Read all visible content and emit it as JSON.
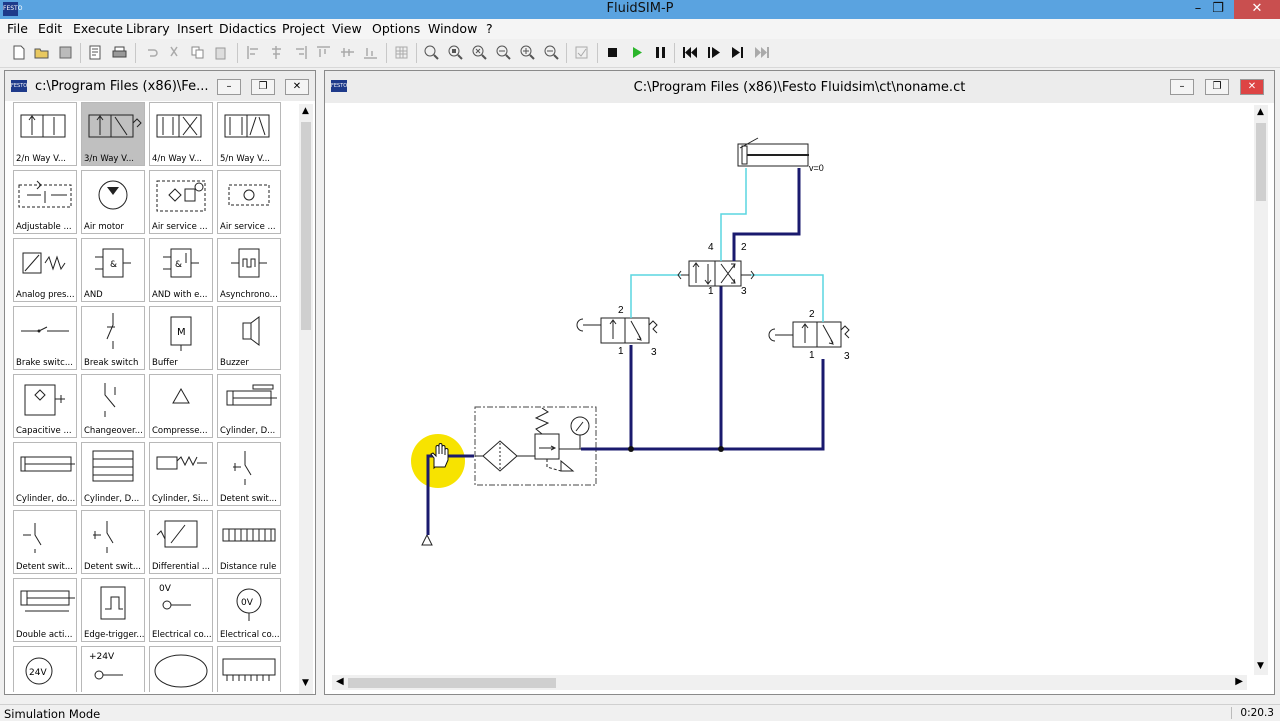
{
  "app": {
    "title": "FluidSIM-P",
    "logo_text": "FESTO"
  },
  "menu": [
    "File",
    "Edit",
    "Execute",
    "Library",
    "Insert",
    "Didactics",
    "Project",
    "View",
    "Options",
    "Window",
    "?"
  ],
  "library": {
    "title": "c:\\Program Files (x86)\\Fe...",
    "items": [
      {
        "label": "2/n Way V...",
        "icon": "valve-2n-icon"
      },
      {
        "label": "3/n Way V...",
        "icon": "valve-3n-icon"
      },
      {
        "label": "4/n Way V...",
        "icon": "valve-4n-icon"
      },
      {
        "label": "5/n Way V...",
        "icon": "valve-5n-icon"
      },
      {
        "label": "Adjustable ...",
        "icon": "adjustable-icon"
      },
      {
        "label": "Air motor",
        "icon": "air-motor-icon"
      },
      {
        "label": "Air service ...",
        "icon": "air-service-icon"
      },
      {
        "label": "Air service ...",
        "icon": "air-service-simple-icon"
      },
      {
        "label": "Analog pres...",
        "icon": "analog-pressure-icon"
      },
      {
        "label": "AND",
        "icon": "and-icon"
      },
      {
        "label": "AND with e...",
        "icon": "and-extended-icon"
      },
      {
        "label": "Asynchrono...",
        "icon": "asynchronous-icon"
      },
      {
        "label": "Brake switc...",
        "icon": "brake-switch-icon"
      },
      {
        "label": "Break switch",
        "icon": "break-switch-icon"
      },
      {
        "label": "Buffer",
        "icon": "buffer-icon"
      },
      {
        "label": "Buzzer",
        "icon": "buzzer-icon"
      },
      {
        "label": "Capacitive ...",
        "icon": "capacitive-icon"
      },
      {
        "label": "Changeover...",
        "icon": "changeover-icon"
      },
      {
        "label": "Compresse...",
        "icon": "compressed-air-icon"
      },
      {
        "label": "Cylinder, D...",
        "icon": "cylinder-d-icon"
      },
      {
        "label": "Cylinder, do...",
        "icon": "cylinder-do-icon"
      },
      {
        "label": "Cylinder, D...",
        "icon": "cylinder-d2-icon"
      },
      {
        "label": "Cylinder, Si...",
        "icon": "cylinder-si-icon"
      },
      {
        "label": "Detent swit...",
        "icon": "detent-switch-icon"
      },
      {
        "label": "Detent swit...",
        "icon": "detent-switch-2-icon"
      },
      {
        "label": "Detent swit...",
        "icon": "detent-switch-3-icon"
      },
      {
        "label": "Differential ...",
        "icon": "differential-icon"
      },
      {
        "label": "Distance rule",
        "icon": "distance-rule-icon"
      },
      {
        "label": "Double acti...",
        "icon": "double-acting-icon"
      },
      {
        "label": "Edge-trigger...",
        "icon": "edge-trigger-icon"
      },
      {
        "label": "Electrical co...",
        "icon": "electrical-connection-icon"
      },
      {
        "label": "Electrical co...",
        "icon": "electrical-ov-icon"
      },
      {
        "label": "",
        "icon": "voltage-24v-icon"
      },
      {
        "label": "",
        "icon": "voltage-24v-terminal-icon"
      },
      {
        "label": "",
        "icon": "ellipse-icon"
      },
      {
        "label": "",
        "icon": "terminal-strip-icon"
      }
    ]
  },
  "circuit": {
    "title": "C:\\Program Files (x86)\\Festo Fluidsim\\ct\\noname.ct",
    "cylinder_label": "v=0",
    "valve_main_ports": [
      "4",
      "2",
      "1",
      "3"
    ],
    "valve_left_ports": [
      "2",
      "1",
      "3"
    ],
    "valve_right_ports": [
      "2",
      "1",
      "3"
    ],
    "colors": {
      "pressure_line": "#1a1a6e",
      "exhaust_line": "#5ad6e0",
      "cursor_highlight": "#f7e300"
    }
  },
  "statusbar": {
    "mode": "Simulation Mode",
    "time": "0:20.3"
  }
}
